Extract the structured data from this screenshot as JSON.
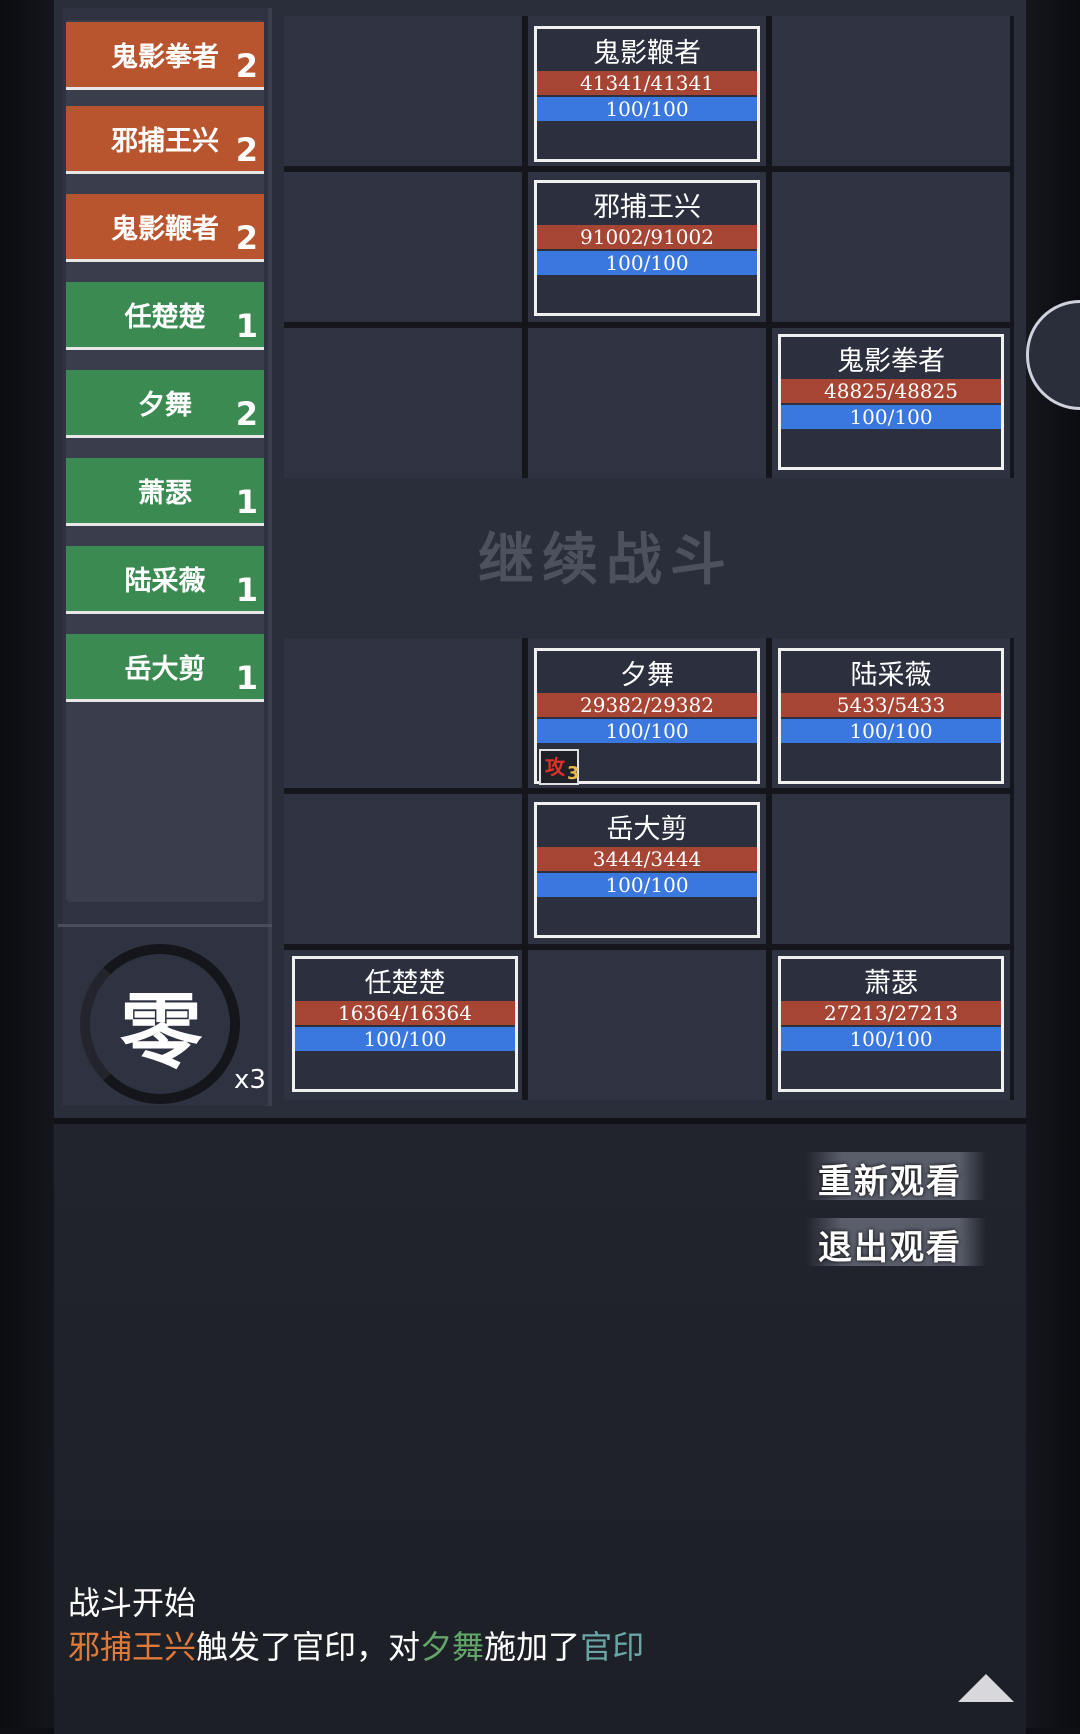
{
  "turn_order": [
    {
      "name": "鬼影拳者",
      "count": "2",
      "side": "enemy"
    },
    {
      "name": "邪捕王兴",
      "count": "2",
      "side": "enemy"
    },
    {
      "name": "鬼影鞭者",
      "count": "2",
      "side": "enemy"
    },
    {
      "name": "任楚楚",
      "count": "1",
      "side": "ally"
    },
    {
      "name": "夕舞",
      "count": "2",
      "side": "ally"
    },
    {
      "name": "萧瑟",
      "count": "1",
      "side": "ally"
    },
    {
      "name": "陆采薇",
      "count": "1",
      "side": "ally"
    },
    {
      "name": "岳大剪",
      "count": "1",
      "side": "ally"
    }
  ],
  "ink_counter": {
    "char": "零",
    "multiplier": "x3"
  },
  "enemy_units": {
    "ghost_whip": {
      "name": "鬼影鞭者",
      "hp": "41341/41341",
      "mp": "100/100"
    },
    "xie_bu": {
      "name": "邪捕王兴",
      "hp": "91002/91002",
      "mp": "100/100"
    },
    "ghost_fist": {
      "name": "鬼影拳者",
      "hp": "48825/48825",
      "mp": "100/100"
    }
  },
  "ally_units": {
    "xi_wu": {
      "name": "夕舞",
      "hp": "29382/29382",
      "mp": "100/100",
      "buff": {
        "char": "攻",
        "count": "3"
      }
    },
    "lu_cai_wei": {
      "name": "陆采薇",
      "hp": "5433/5433",
      "mp": "100/100"
    },
    "yue_da_jian": {
      "name": "岳大剪",
      "hp": "3444/3444",
      "mp": "100/100"
    },
    "ren_chu_chu": {
      "name": "任楚楚",
      "hp": "16364/16364",
      "mp": "100/100"
    },
    "xiao_se": {
      "name": "萧瑟",
      "hp": "27213/27213",
      "mp": "100/100"
    }
  },
  "continue_label": "继续战斗",
  "buttons": {
    "replay": "重新观看",
    "exit": "退出观看"
  },
  "log": {
    "line1": "战斗开始",
    "line2": {
      "actor": "邪捕王兴",
      "text1": "触发了官印，对",
      "target": "夕舞",
      "text2": "施加了",
      "effect": "官印"
    }
  },
  "colors": {
    "enemy_turn": "#b8552f",
    "ally_turn": "#3b8a52",
    "hp_bar": "#a74535",
    "mp_bar": "#3a78e0",
    "log_enemy": "#e07a3a",
    "log_ally": "#63a66a",
    "log_skill": "#6aa6a6"
  }
}
